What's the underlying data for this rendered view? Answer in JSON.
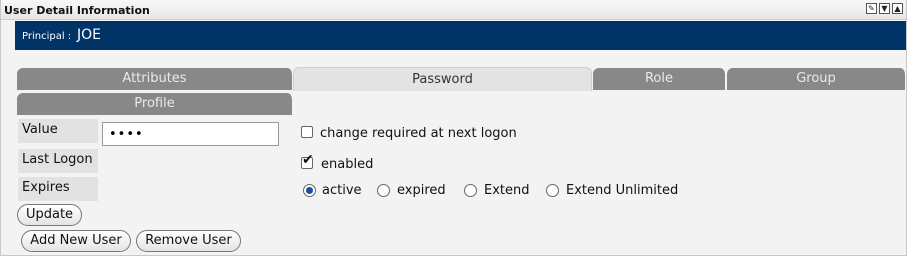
{
  "window": {
    "title": "User Detail Information",
    "controls": [
      "edit-icon",
      "minimize-icon",
      "maximize-icon"
    ]
  },
  "principal": {
    "label": "Principal :",
    "value": "JOE"
  },
  "tabs": [
    {
      "label": "Attributes",
      "active": false
    },
    {
      "label": "Password",
      "active": true
    },
    {
      "label": "Role",
      "active": false
    },
    {
      "label": "Group",
      "active": false
    },
    {
      "label": "Profile",
      "active": false
    }
  ],
  "fields": {
    "value_label": "Value",
    "value_masked": "••••",
    "last_logon_label": "Last Logon",
    "expires_label": "Expires"
  },
  "options": {
    "change_required_label": "change required at next logon",
    "change_required_checked": false,
    "enabled_label": "enabled",
    "enabled_checked": true,
    "radios": [
      {
        "label": "active",
        "selected": true
      },
      {
        "label": "expired",
        "selected": false
      },
      {
        "label": "Extend",
        "selected": false
      },
      {
        "label": "Extend Unlimited",
        "selected": false
      }
    ]
  },
  "buttons": {
    "update": "Update",
    "add_new_user": "Add New User",
    "remove_user": "Remove User"
  },
  "colors": {
    "header_bg": "#003366",
    "tab_inactive": "#888888",
    "tab_active": "#e3e3e3",
    "radio_accent": "#1a4fa0"
  }
}
